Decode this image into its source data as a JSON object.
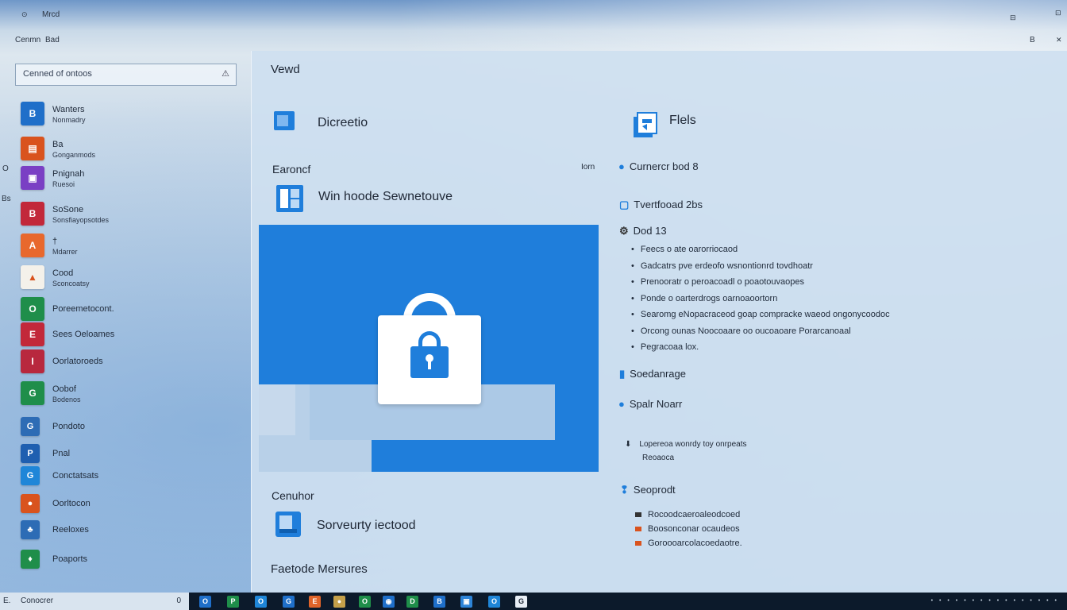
{
  "top_bar": {
    "menu_icon_glyph": "⊙",
    "title": "Mrcd",
    "line2_a": "Cenmn",
    "line2_b": "Bad",
    "right_top": "⊡",
    "right_mid": "⊟",
    "right_line2_text": "B",
    "right_line2_glyph": "✕"
  },
  "sidebar": {
    "search": {
      "value": "Cenned of ontoos",
      "icon": "warning-icon"
    },
    "edge_a": "O",
    "edge_b": "Bs",
    "apps": [
      {
        "icon_color": "#1f6fc9",
        "letter": "B",
        "line1": "Wanters",
        "line2": "Nonmadry"
      },
      {
        "icon_color": "#d9531e",
        "letter": "▤",
        "line1": "Ba",
        "line2": "Gonganmods"
      },
      {
        "icon_color": "#7a3fc4",
        "letter": "▣",
        "line1": "Pnignah",
        "line2": "Ruesoi"
      },
      {
        "icon_color": "#c2283a",
        "letter": "B",
        "line1": "SoSone",
        "line2": "Sonsfiayopsotdes"
      },
      {
        "icon_color": "#e8682d",
        "letter": "A",
        "line1": "†",
        "line2": "Mdarrer"
      },
      {
        "icon_color": "#f4f1ea",
        "letter": "▲",
        "line1": "Cood",
        "line2": "Sconcoatsy"
      },
      {
        "icon_color": "#1f8e4a",
        "letter": "O",
        "line1": "Poreemetocont.",
        "line2": ""
      },
      {
        "icon_color": "#c2283a",
        "letter": "E",
        "line1": "Sees Oeloames",
        "line2": ""
      },
      {
        "icon_color": "#b8283e",
        "letter": "I",
        "line1": "Oorlatoroeds",
        "line2": ""
      },
      {
        "icon_color": "#1f8e4a",
        "letter": "G",
        "line1": "Oobof",
        "line2": "Bodenos"
      },
      {
        "icon_color": "#2d6cb5",
        "letter": "G",
        "line1": "Pondoto",
        "line2": ""
      },
      {
        "icon_color": "#1f5fb0",
        "letter": "P",
        "line1": "Pnal",
        "line2": ""
      },
      {
        "icon_color": "#1f86d8",
        "letter": "G",
        "line1": "Conctatsats",
        "line2": ""
      },
      {
        "icon_color": "#d9531e",
        "letter": "●",
        "line1": "Oorltocon",
        "line2": ""
      },
      {
        "icon_color": "#2d6cb5",
        "letter": "♣",
        "line1": "Reeloxes",
        "line2": ""
      },
      {
        "icon_color": "#1f8e4a",
        "letter": "♦",
        "line1": "Poaports",
        "line2": ""
      }
    ]
  },
  "main": {
    "section_title": "Vewd",
    "left": {
      "item1": "Dicreetio",
      "label_1": "Earoncf",
      "label_1_right": "Iorn",
      "item2": "Win hoode Sewnetouve",
      "label_2": "Cenuhor",
      "item3": "Sorveurty iectood",
      "footer": "Faetode Mersures"
    },
    "right": {
      "header": "Flels",
      "r1": "Curnercr bod 8",
      "r2": "Tvertfooad 2bs",
      "r3": "Dod 13",
      "bullets": [
        "Feecs o ate oarorriocaod",
        "Gadcatrs pve erdeofo wsnontionrd tovdhoatr",
        "Prenooratr o peroacoadl o poaotouvaopes",
        "Ponde o oarterdrogs oarnoaoortorn",
        "Searomg eNopacraceod goap compracke waeod ongonycoodoc",
        "Orcong ounas Noocoaare oo oucoaoare Porarcanoaal",
        "Pegracoaa lox."
      ],
      "r4": "Soedanrage",
      "r5": "Spalr Noarr",
      "r6_line1": "Lopereoa wonrdy toy onrpeats",
      "r6_line2": "Reoaoca",
      "r7": "Seoprodt",
      "sub": [
        {
          "text": "Rocoodcaeroaleodcoed",
          "color": "#333333"
        },
        {
          "text": "Boosonconar ocaudeos",
          "color": "#d9531e"
        },
        {
          "text": "Goroooarcolacoedaotre.",
          "color": "#d9531e"
        }
      ]
    }
  },
  "taskbar": {
    "search_a": "E.",
    "search_b": "Conocrer",
    "search_c": "0",
    "icons": [
      {
        "color": "#1f6fc9",
        "glyph": "O"
      },
      {
        "color": "#1f8e4a",
        "glyph": "P"
      },
      {
        "color": "#1f86d8",
        "glyph": "O"
      },
      {
        "color": "#1f6fc9",
        "glyph": "G"
      },
      {
        "color": "#e0642a",
        "glyph": "E"
      },
      {
        "color": "#c5a04a",
        "glyph": "●"
      },
      {
        "color": "#1f8e4a",
        "glyph": "O"
      },
      {
        "color": "#1f6fc9",
        "glyph": "◉"
      },
      {
        "color": "#1f8e4a",
        "glyph": "D"
      },
      {
        "color": "#1f6fc9",
        "glyph": "B"
      },
      {
        "color": "#2d84d8",
        "glyph": "▣"
      },
      {
        "color": "#1f86d8",
        "glyph": "O"
      },
      {
        "color": "#e8eef5",
        "glyph": "G"
      }
    ],
    "tray": "• • • • • • • • • • • • • • • •"
  },
  "colors": {
    "accent": "#1f7edb",
    "taskbar": "#0c1a2b"
  }
}
